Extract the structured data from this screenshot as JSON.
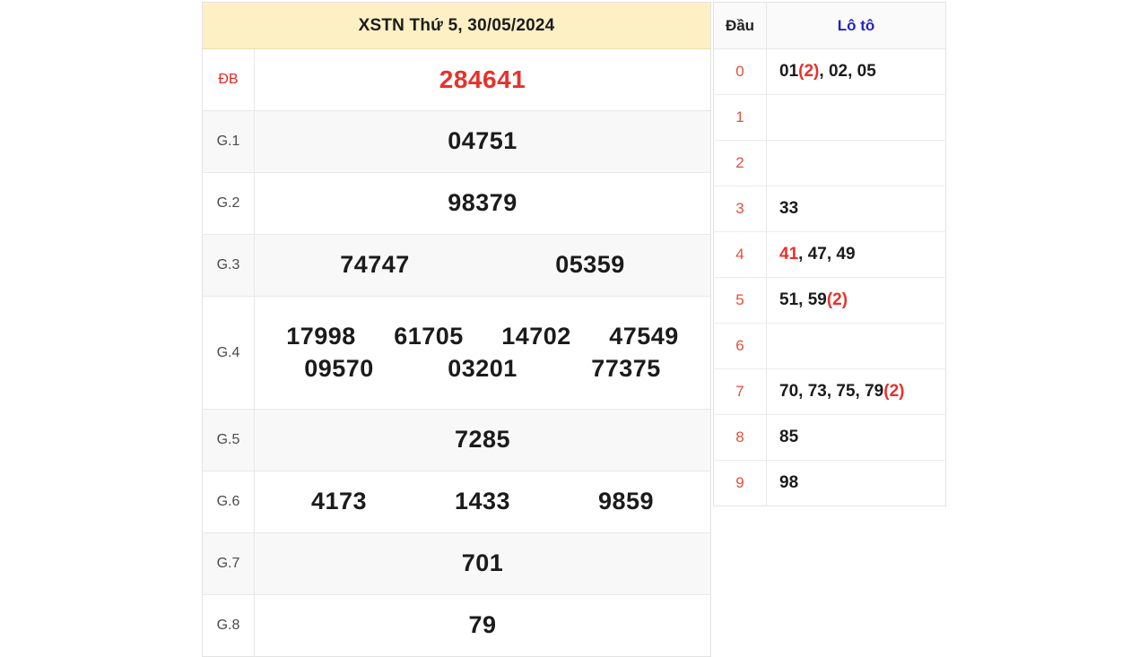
{
  "results": {
    "title": "XSTN Thứ 5, 30/05/2024",
    "rows": [
      {
        "label": "ĐB",
        "special": true,
        "lines": [
          [
            "284641"
          ]
        ]
      },
      {
        "label": "G.1",
        "special": false,
        "lines": [
          [
            "04751"
          ]
        ]
      },
      {
        "label": "G.2",
        "special": false,
        "lines": [
          [
            "98379"
          ]
        ]
      },
      {
        "label": "G.3",
        "special": false,
        "lines": [
          [
            "74747",
            "05359"
          ]
        ]
      },
      {
        "label": "G.4",
        "special": false,
        "lines": [
          [
            "17998",
            "61705",
            "14702",
            "47549"
          ],
          [
            "09570",
            "03201",
            "77375"
          ]
        ]
      },
      {
        "label": "G.5",
        "special": false,
        "lines": [
          [
            "7285"
          ]
        ]
      },
      {
        "label": "G.6",
        "special": false,
        "lines": [
          [
            "4173",
            "1433",
            "9859"
          ]
        ]
      },
      {
        "label": "G.7",
        "special": false,
        "lines": [
          [
            "701"
          ]
        ]
      },
      {
        "label": "G.8",
        "special": false,
        "lines": [
          [
            "79"
          ]
        ]
      }
    ]
  },
  "loto": {
    "header_dau": "Đầu",
    "header_loto": "Lô tô",
    "rows": [
      {
        "dau": "0",
        "numbers": [
          {
            "value": "01",
            "dup": "(2)",
            "hot": false
          },
          {
            "value": "02",
            "dup": "",
            "hot": false
          },
          {
            "value": "05",
            "dup": "",
            "hot": false
          }
        ]
      },
      {
        "dau": "1",
        "numbers": []
      },
      {
        "dau": "2",
        "numbers": []
      },
      {
        "dau": "3",
        "numbers": [
          {
            "value": "33",
            "dup": "",
            "hot": false
          }
        ]
      },
      {
        "dau": "4",
        "numbers": [
          {
            "value": "41",
            "dup": "",
            "hot": true
          },
          {
            "value": "47",
            "dup": "",
            "hot": false
          },
          {
            "value": "49",
            "dup": "",
            "hot": false
          }
        ]
      },
      {
        "dau": "5",
        "numbers": [
          {
            "value": "51",
            "dup": "",
            "hot": false
          },
          {
            "value": "59",
            "dup": "(2)",
            "hot": false
          }
        ]
      },
      {
        "dau": "6",
        "numbers": []
      },
      {
        "dau": "7",
        "numbers": [
          {
            "value": "70",
            "dup": "",
            "hot": false
          },
          {
            "value": "73",
            "dup": "",
            "hot": false
          },
          {
            "value": "75",
            "dup": "",
            "hot": false
          },
          {
            "value": "79",
            "dup": "(2)",
            "hot": false
          }
        ]
      },
      {
        "dau": "8",
        "numbers": [
          {
            "value": "85",
            "dup": "",
            "hot": false
          }
        ]
      },
      {
        "dau": "9",
        "numbers": [
          {
            "value": "98",
            "dup": "",
            "hot": false
          }
        ]
      }
    ]
  },
  "colors": {
    "title_bg": "#fdf0c4",
    "special_red": "#e8312a",
    "loto_header_blue": "#2222cc",
    "dau_red": "#e0523c",
    "row_shade": "#f8f8f8"
  }
}
